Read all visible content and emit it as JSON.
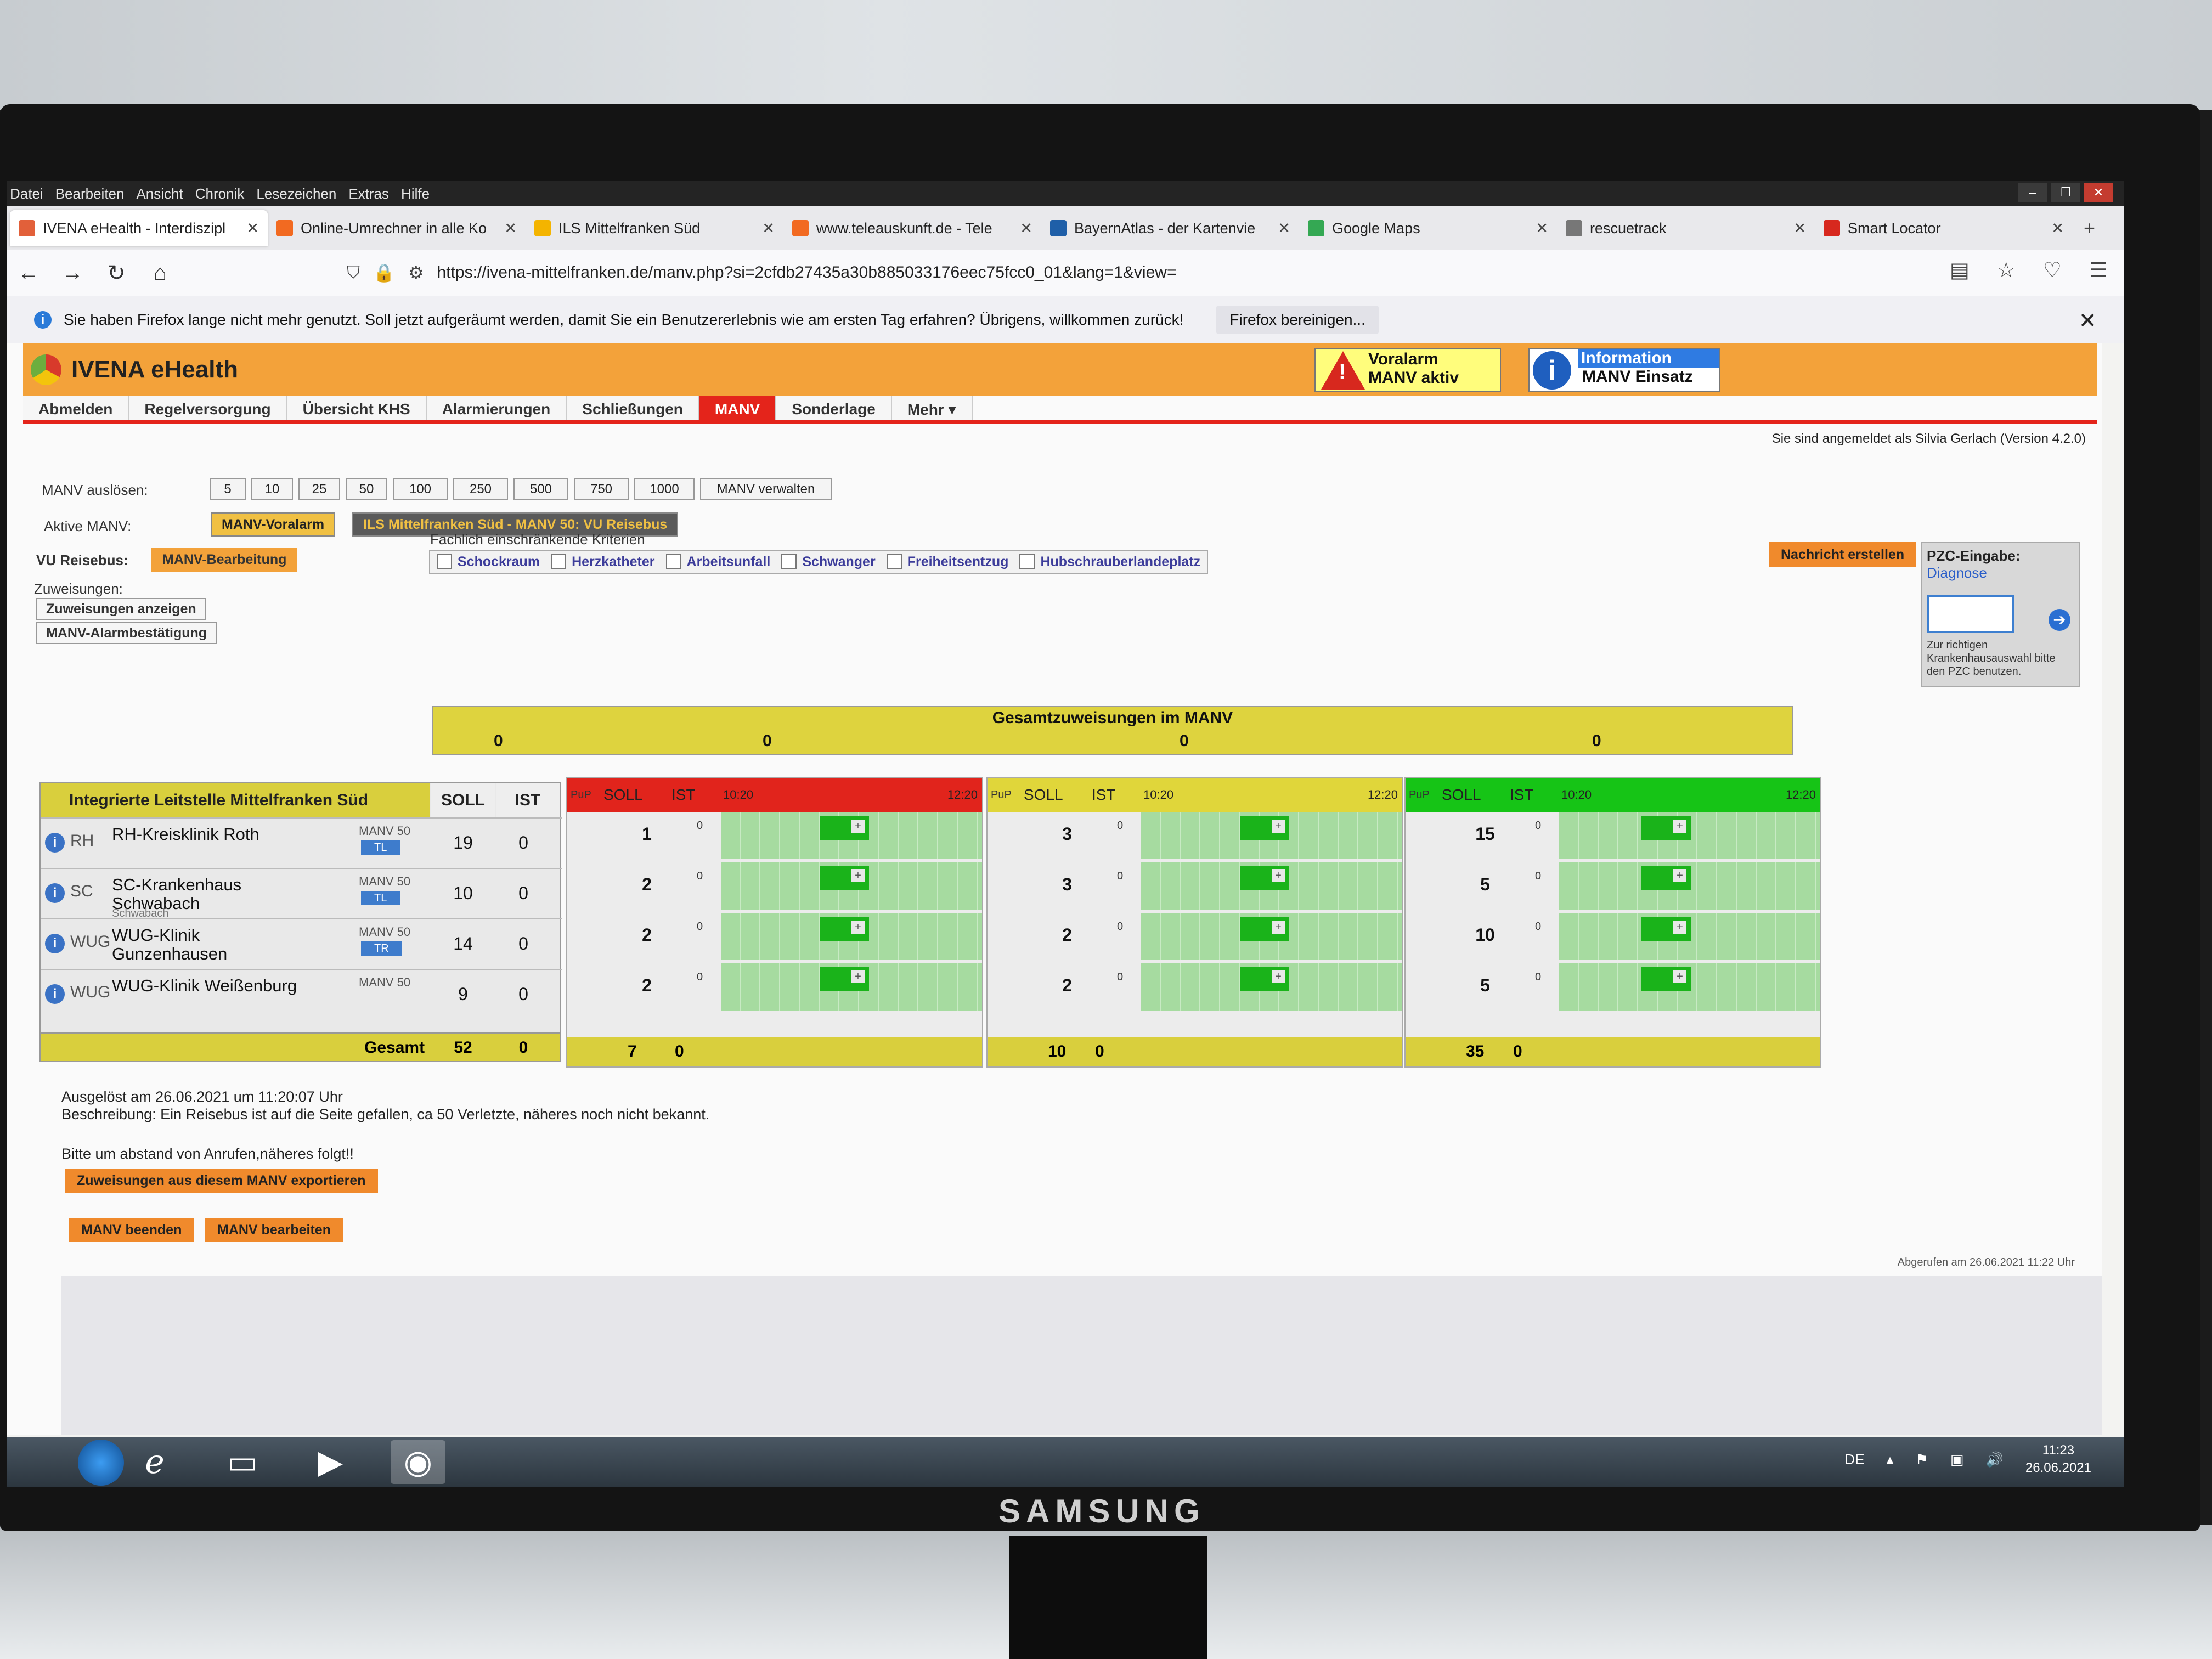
{
  "browser": {
    "menu": [
      "Datei",
      "Bearbeiten",
      "Ansicht",
      "Chronik",
      "Lesezeichen",
      "Extras",
      "Hilfe"
    ],
    "tabs": [
      {
        "label": "IVENA eHealth - Interdiszipl",
        "color": "#e2603a"
      },
      {
        "label": "Online-Umrechner in alle Ko",
        "color": "#f26a21"
      },
      {
        "label": "ILS Mittelfranken Süd",
        "color": "#f4b400"
      },
      {
        "label": "www.teleauskunft.de - Tele",
        "color": "#f26a21"
      },
      {
        "label": "BayernAtlas - der Kartenvie",
        "color": "#1f5fa8"
      },
      {
        "label": "Google Maps",
        "color": "#34a853"
      },
      {
        "label": "rescuetrack",
        "color": "#777777"
      },
      {
        "label": "Smart Locator",
        "color": "#d7281e"
      }
    ],
    "url": "https://ivena-mittelfranken.de/manv.php?si=2cfdb27435a30b885033176eec75fcc0_01&lang=1&view=",
    "notification": "Sie haben Firefox lange nicht mehr genutzt. Soll jetzt aufgeräumt werden, damit Sie ein Benutzererlebnis wie am ersten Tag erfahren? Übrigens, willkommen zurück!",
    "notification_button": "Firefox bereinigen..."
  },
  "app": {
    "title": "IVENA eHealth",
    "alert1": [
      "Voralarm",
      "MANV aktiv"
    ],
    "alert2": [
      "Information",
      "MANV Einsatz"
    ],
    "nav": [
      "Abmelden",
      "Regelversorgung",
      "Übersicht KHS",
      "Alarmierungen",
      "Schließungen",
      "MANV",
      "Sonderlage",
      "Mehr ▾"
    ],
    "login": "Sie sind angemeldet als Silvia Gerlach (Version 4.2.0)",
    "manv_ausloesen_label": "MANV auslösen:",
    "manv_buttons": [
      "5",
      "10",
      "25",
      "50",
      "100",
      "250",
      "500",
      "750",
      "1000"
    ],
    "manv_verwalten": "MANV verwalten",
    "aktive_label": "Aktive MANV:",
    "aktive_chip1": "MANV-Voralarm",
    "aktive_chip2": "ILS Mittelfranken Süd - MANV 50: VU Reisebus",
    "vu_label": "VU Reisebus:",
    "vu_chip": "MANV-Bearbeitung",
    "zuweisungen_label": "Zuweisungen:",
    "btn_zuweisungen": "Zuweisungen anzeigen",
    "btn_alarm": "MANV-Alarmbestätigung",
    "kriterien_label": "Fachlich einschränkende Kriterien",
    "kriterien": [
      "Schockraum",
      "Herzkatheter",
      "Arbeitsunfall",
      "Schwanger",
      "Freiheitsentzug",
      "Hubschrauberlandeplatz"
    ],
    "nachricht": "Nachricht erstellen",
    "pzc_title": "PZC-Eingabe:",
    "pzc_link": "Diagnose",
    "pzc_hint": "Zur richtigen Krankenhausauswahl bitte den PZC benutzen.",
    "gesamt_title": "Gesamtzuweisungen im MANV",
    "gesamt_values": [
      "0",
      "0",
      "0",
      "0"
    ],
    "table_title": "Integrierte Leitstelle Mittelfranken Süd",
    "col_soll": "SOLL",
    "col_ist": "IST",
    "col_pup": "PuP",
    "time_start": "10:20",
    "time_end": "12:20",
    "hospitals": [
      {
        "abbr": "RH",
        "name": "RH-Kreisklinik Roth",
        "sub": "",
        "manv": "MANV 50",
        "badge": "TL",
        "soll": "19",
        "ist": "0",
        "b": [
          "1",
          "3",
          "15"
        ]
      },
      {
        "abbr": "SC",
        "name": "SC-Krankenhaus Schwabach",
        "sub": "Schwabach",
        "manv": "MANV 50",
        "badge": "TL",
        "soll": "10",
        "ist": "0",
        "b": [
          "2",
          "3",
          "5"
        ]
      },
      {
        "abbr": "WUG",
        "name": "WUG-Klinik Gunzenhausen",
        "sub": "",
        "manv": "MANV 50",
        "badge": "TR",
        "soll": "14",
        "ist": "0",
        "b": [
          "2",
          "2",
          "10"
        ]
      },
      {
        "abbr": "WUG",
        "name": "WUG-Klinik Weißenburg",
        "sub": "",
        "manv": "MANV 50",
        "badge": "",
        "soll": "9",
        "ist": "0",
        "b": [
          "2",
          "2",
          "5"
        ]
      }
    ],
    "gesamt_label": "Gesamt",
    "gesamt_soll": "52",
    "gesamt_ist": "0",
    "block_totals": [
      [
        "7",
        "0"
      ],
      [
        "10",
        "0"
      ],
      [
        "35",
        "0"
      ]
    ],
    "ausgeloest": "Ausgelöst am 26.06.2021 um 11:20:07 Uhr",
    "beschreibung": "Beschreibung: Ein Reisebus ist auf die Seite gefallen, ca 50 Verletzte, näheres noch nicht bekannt.",
    "bitte": "Bitte um abstand von Anrufen,näheres folgt!!",
    "export_btn": "Zuweisungen aus diesem MANV exportieren",
    "beenden_btn": "MANV beenden",
    "bearbeiten_btn": "MANV bearbeiten",
    "abgerufen": "Abgerufen am 26.06.2021 11:22 Uhr",
    "block_colors": [
      "#e1241c",
      "#e0d63a",
      "#16c416"
    ]
  },
  "taskbar": {
    "lang": "DE",
    "time": "11:23",
    "date": "26.06.2021"
  },
  "monitor": {
    "brand": "SAMSUNG"
  }
}
